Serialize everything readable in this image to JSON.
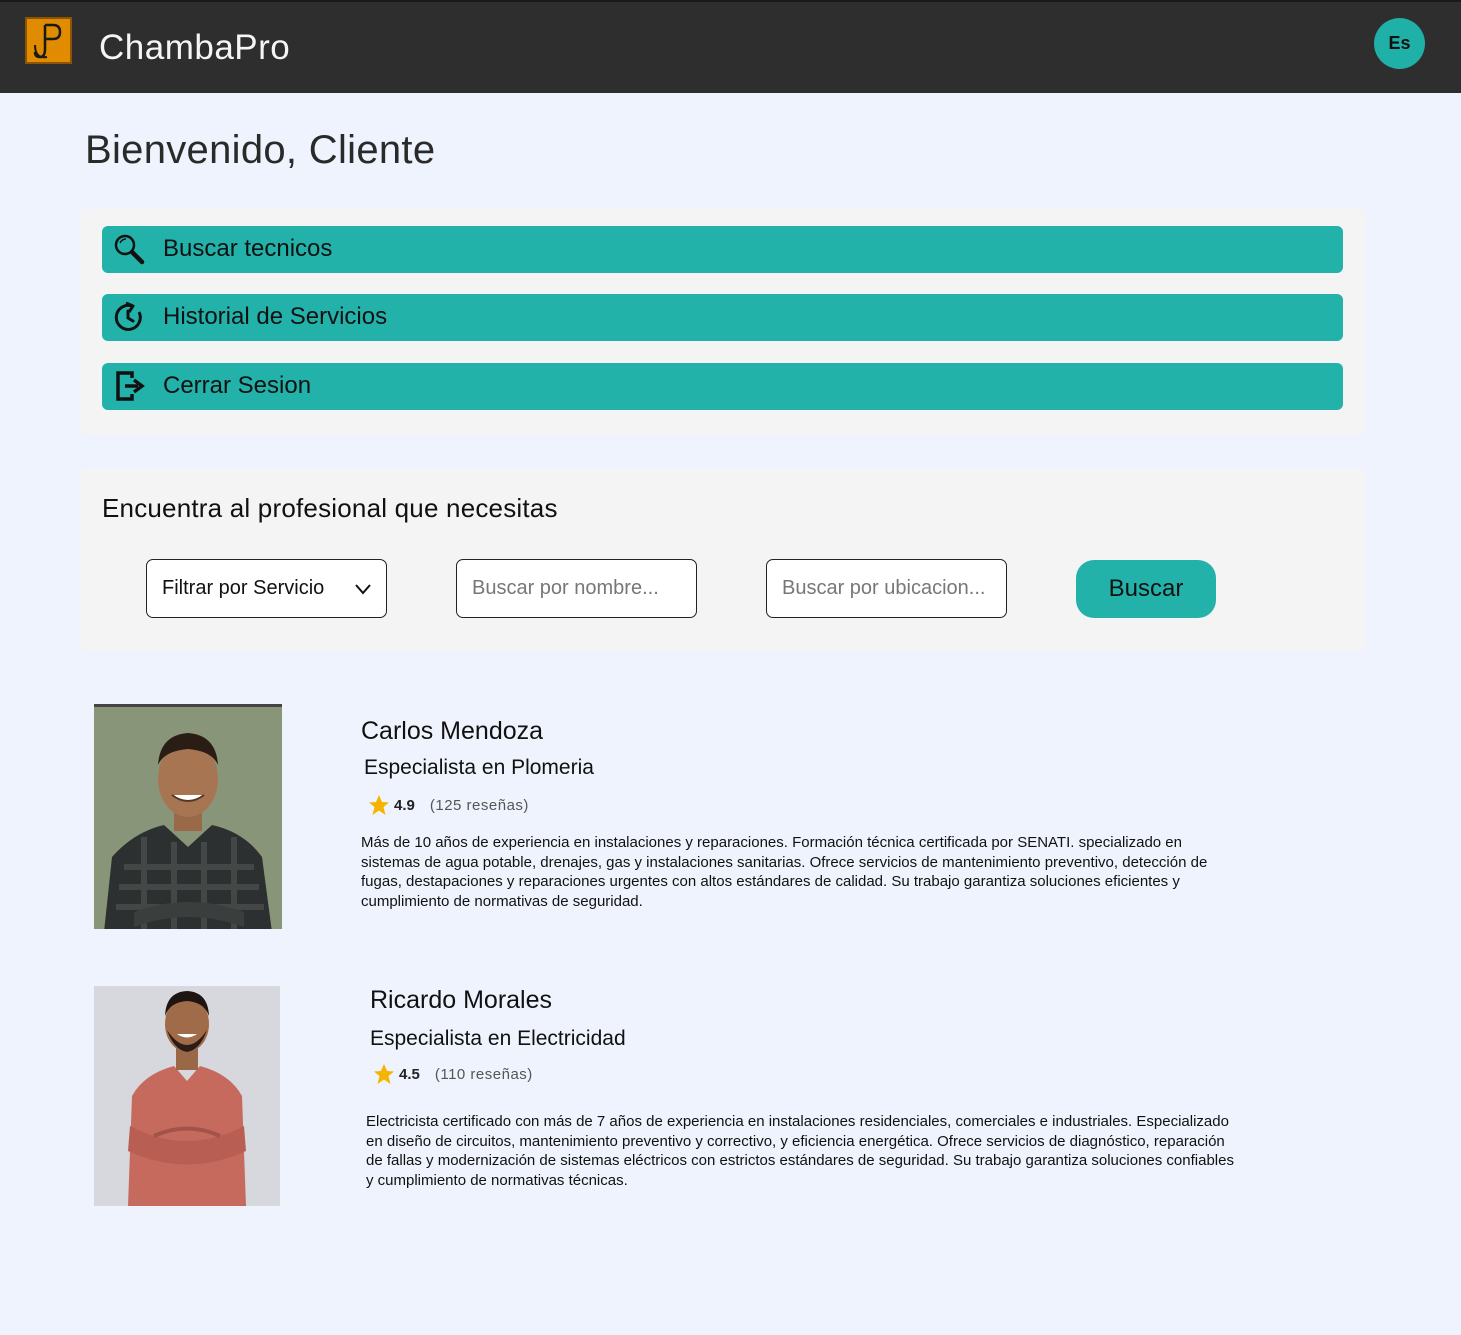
{
  "header": {
    "brand": "ChambaPro",
    "avatar_initials": "Es"
  },
  "welcome": "Bienvenido, Cliente",
  "menu": {
    "search_techs": "Buscar tecnicos",
    "history": "Historial de Servicios",
    "logout": "Cerrar Sesion"
  },
  "search": {
    "title": "Encuentra al profesional que necesitas",
    "filter_label": "Filtrar por Servicio",
    "name_placeholder": "Buscar por nombre...",
    "location_placeholder": "Buscar por ubicacion...",
    "button": "Buscar"
  },
  "professionals": [
    {
      "name": "Carlos Mendoza",
      "specialty": "Especialista en Plomeria",
      "rating": "4.9",
      "reviews": "(125 reseñas)",
      "description": "Más de 10 años de experiencia en instalaciones y reparaciones. Formación técnica certificada por SENATI. specializado en sistemas de agua potable, drenajes, gas y instalaciones sanitarias. Ofrece servicios de mantenimiento preventivo, detección de fugas, destapaciones y reparaciones urgentes con altos estándares de calidad. Su trabajo garantiza soluciones eficientes y cumplimiento de normativas de seguridad."
    },
    {
      "name": "Ricardo Morales",
      "specialty": "Especialista en Electricidad",
      "rating": "4.5",
      "reviews": "(110 reseñas)",
      "description": "Electricista certificado con más de 7 años de experiencia en instalaciones residenciales, comerciales e industriales. Especializado en diseño de circuitos, mantenimiento preventivo y correctivo, y eficiencia energética. Ofrece servicios de diagnóstico, reparación de fallas y modernización de sistemas eléctricos con estrictos estándares de seguridad. Su trabajo garantiza soluciones confiables y cumplimiento de normativas técnicas."
    }
  ],
  "colors": {
    "accent": "#22b2aa",
    "header_bg": "#2e2e2e",
    "logo": "#e08b00",
    "page_bg": "#eef3fd",
    "star": "#f4b400"
  }
}
